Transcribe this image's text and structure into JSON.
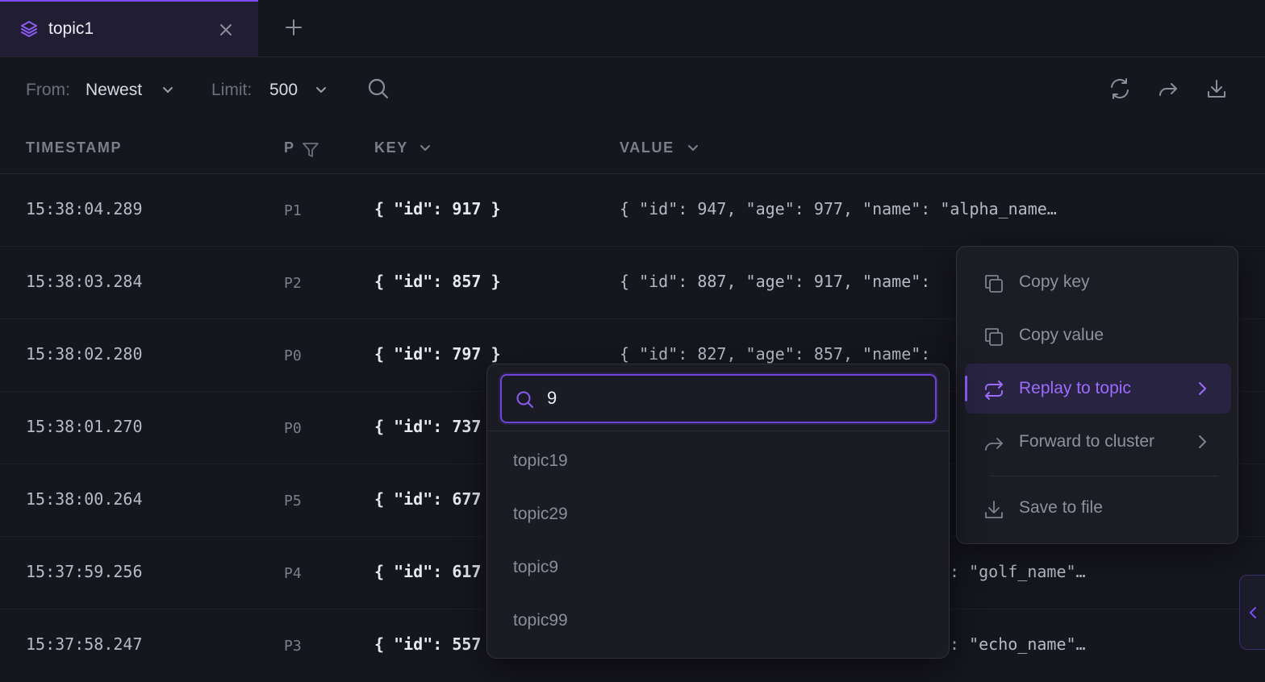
{
  "tab": {
    "title": "topic1",
    "icon": "layers-icon"
  },
  "toolbar": {
    "from_label": "From:",
    "from_value": "Newest",
    "limit_label": "Limit:",
    "limit_value": "500"
  },
  "table": {
    "headers": {
      "timestamp": "TIMESTAMP",
      "partition": "P",
      "key": "KEY",
      "value": "VALUE"
    },
    "rows": [
      {
        "timestamp": "15:38:04.289",
        "partition": "P1",
        "key": "{ \"id\": 917 }",
        "value": "{ \"id\": 947, \"age\": 977, \"name\": \"alpha_name…"
      },
      {
        "timestamp": "15:38:03.284",
        "partition": "P2",
        "key": "{ \"id\": 857 }",
        "value": "{ \"id\": 887, \"age\": 917, \"name\":"
      },
      {
        "timestamp": "15:38:02.280",
        "partition": "P0",
        "key": "{ \"id\": 797 }",
        "value": "{ \"id\": 827, \"age\": 857, \"name\":"
      },
      {
        "timestamp": "15:38:01.270",
        "partition": "P0",
        "key": "{ \"id\": 737",
        "value": ""
      },
      {
        "timestamp": "15:38:00.264",
        "partition": "P5",
        "key": "{ \"id\": 677",
        "value": ""
      },
      {
        "timestamp": "15:37:59.256",
        "partition": "P4",
        "key": "{ \"id\": 617",
        "value": ": \"golf_name\"…"
      },
      {
        "timestamp": "15:37:58.247",
        "partition": "P3",
        "key": "{ \"id\": 557",
        "value": ": \"echo_name\"…"
      }
    ]
  },
  "context_menu": {
    "items": [
      {
        "label": "Copy key"
      },
      {
        "label": "Copy value"
      },
      {
        "label": "Replay to topic"
      },
      {
        "label": "Forward to cluster"
      },
      {
        "label": "Save to file"
      }
    ]
  },
  "topic_picker": {
    "query": "9",
    "results": [
      "topic19",
      "topic29",
      "topic9",
      "topic99"
    ]
  },
  "colors": {
    "accent": "#8b5cf6",
    "background": "#16171e",
    "menu_bg": "#1b1c24"
  }
}
